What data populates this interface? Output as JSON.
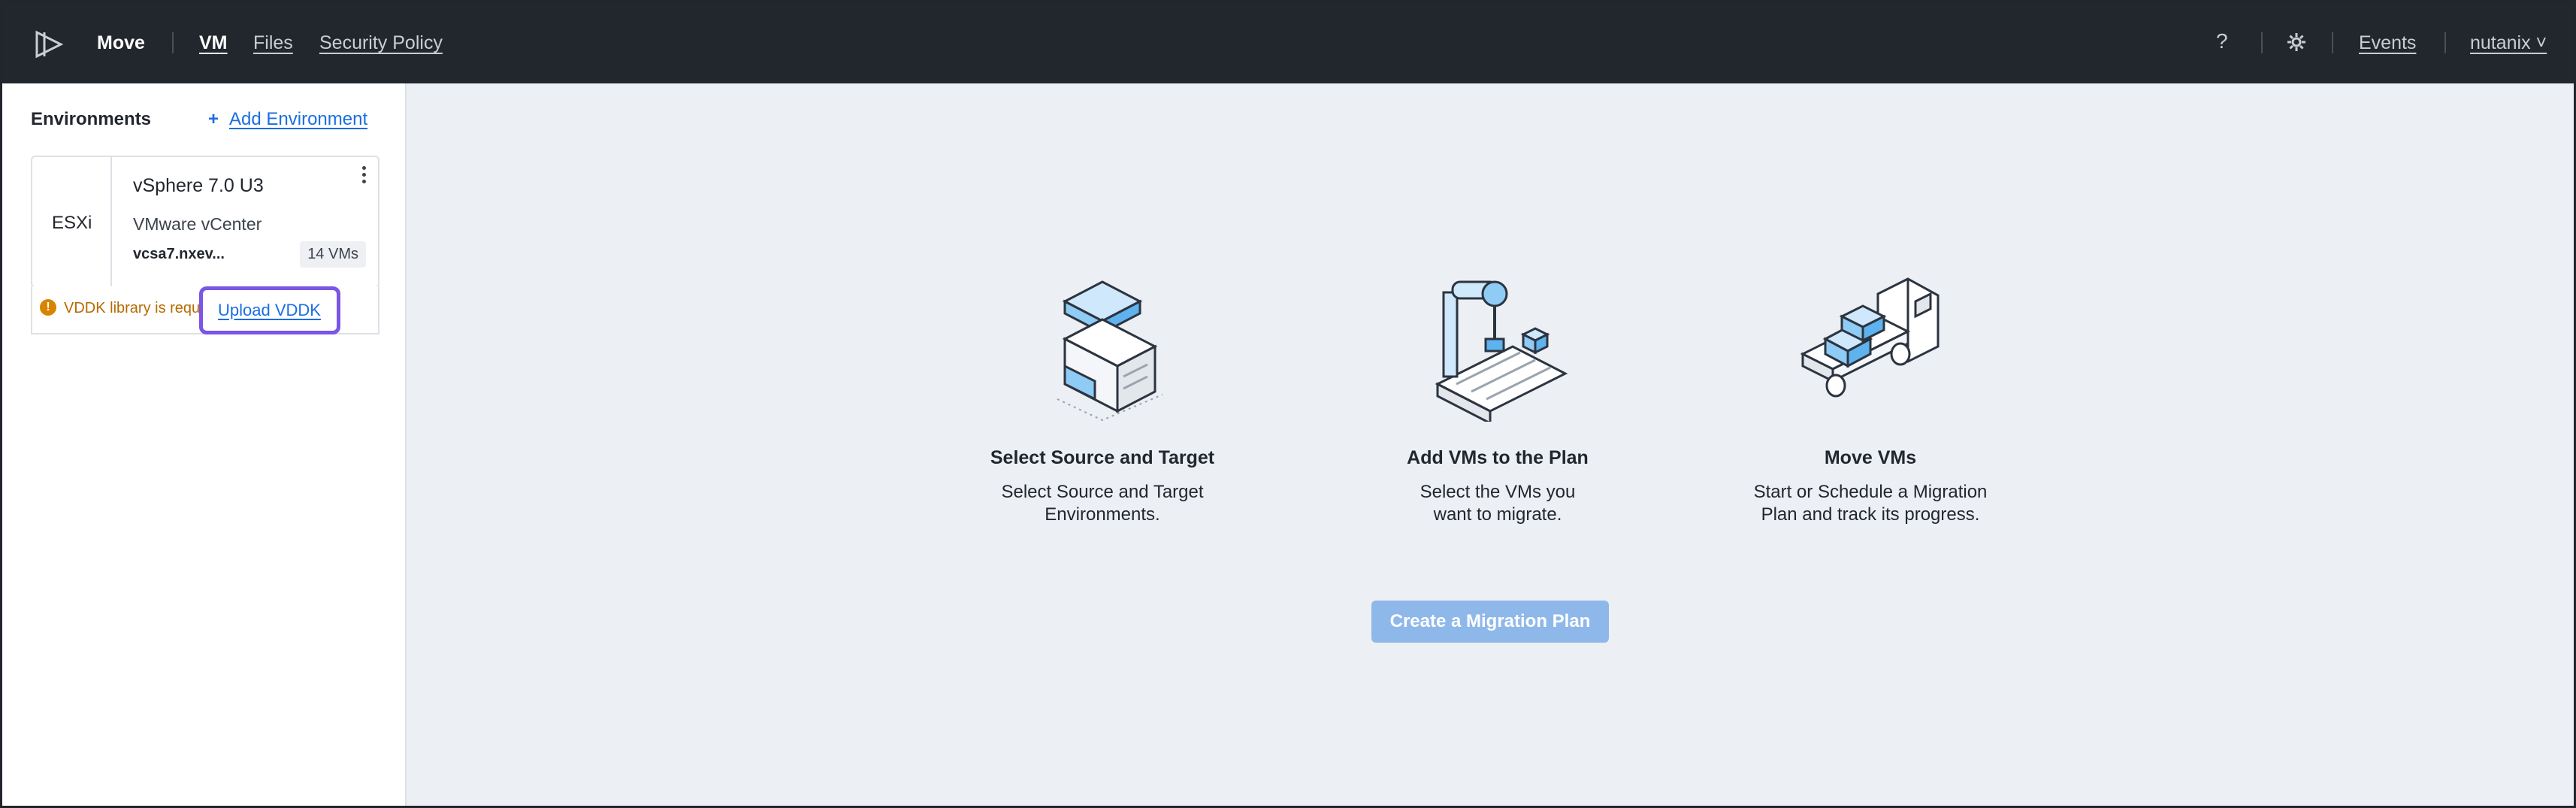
{
  "header": {
    "app_name": "Move",
    "nav": [
      {
        "label": "VM",
        "active": true
      },
      {
        "label": "Files",
        "active": false
      },
      {
        "label": "Security Policy",
        "active": false
      }
    ],
    "help_icon": "?",
    "settings_icon": "gear-icon",
    "events_label": "Events",
    "user_label": "nutanix ˅"
  },
  "sidebar": {
    "title": "Environments",
    "add_icon": "+",
    "add_label": "Add Environment",
    "environments": [
      {
        "type": "ESXi",
        "name": "vSphere 7.0 U3",
        "subtype": "VMware vCenter",
        "host": "vcsa7.nxev...",
        "vm_count": "14 VMs",
        "warning_text": "VDDK library is require...",
        "warning_icon": "!",
        "action_label": "Upload VDDK"
      }
    ]
  },
  "main": {
    "steps": [
      {
        "title": "Select Source and Target",
        "desc_line1": "Select Source and Target",
        "desc_line2": "Environments."
      },
      {
        "title": "Add VMs to the Plan",
        "desc_line1": "Select the VMs you",
        "desc_line2": "want to migrate."
      },
      {
        "title": "Move VMs",
        "desc_line1": "Start or Schedule a Migration",
        "desc_line2": "Plan and track its progress."
      }
    ],
    "cta_label": "Create a Migration Plan"
  },
  "colors": {
    "header_bg": "#22272e",
    "accent": "#1b6ee0",
    "warning": "#d88400",
    "highlight": "#7a55e6",
    "cta_bg": "#8fb8ea"
  }
}
